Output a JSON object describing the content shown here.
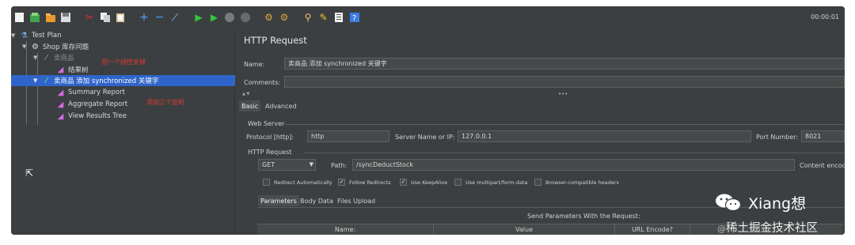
{
  "toolbar": {
    "icons": [
      "new-icon",
      "templates-icon",
      "open-icon",
      "save-icon",
      "cut-icon",
      "copy-icon",
      "paste-icon",
      "expand-icon",
      "collapse-icon",
      "toggle-icon",
      "start-icon",
      "start-no-pauses-icon",
      "stop-icon",
      "shutdown-icon",
      "clear-icon",
      "clear-all-icon",
      "search-icon",
      "reset-search-icon",
      "function-helper-icon",
      "help-icon"
    ],
    "timer": "00:00:01"
  },
  "tree": {
    "items": [
      {
        "label": "Test Plan"
      },
      {
        "label": "Shop 库存问题"
      },
      {
        "label": "卖商品"
      },
      {
        "label": "结果树"
      },
      {
        "label": "卖商品 添加 synchronized 关键字"
      },
      {
        "label": "Summary Report"
      },
      {
        "label": "Aggregate Report"
      },
      {
        "label": "View Results Tree"
      }
    ],
    "annotations": [
      "测一个线性关掉",
      "添加三个监听"
    ]
  },
  "panel": {
    "title": "HTTP Request",
    "name_label": "Name:",
    "name_value": "卖商品 添加 synchronized 关键字",
    "comments_label": "Comments:",
    "tabs": [
      "Basic",
      "Advanced"
    ],
    "web_server_label": "Web Server",
    "protocol_label": "Protocol [http]:",
    "protocol_value": "http",
    "server_label": "Server Name or IP:",
    "server_value": "127.0.0.1",
    "port_label": "Port Number:",
    "port_value": "8021",
    "http_request_label": "HTTP Request",
    "method_value": "GET",
    "path_label": "Path:",
    "path_value": "/syncDeductStock",
    "content_encoding_label": "Content encoding",
    "checkboxes": [
      {
        "label": "Redirect Automatically",
        "checked": false
      },
      {
        "label": "Follow Redirects",
        "checked": true
      },
      {
        "label": "Use KeepAlive",
        "checked": true
      },
      {
        "label": "Use multipart/form-data",
        "checked": false
      },
      {
        "label": "Browser-compatible headers",
        "checked": false
      }
    ],
    "sub_tabs": [
      "Parameters",
      "Body Data",
      "Files Upload"
    ],
    "send_params_label": "Send Parameters With the Request:",
    "table_headers": [
      "Name:",
      "Value",
      "URL Encode?",
      ""
    ]
  },
  "watermark": {
    "name": "Xiang想",
    "site_at": "@",
    "site": "稀土掘金技术社区"
  }
}
